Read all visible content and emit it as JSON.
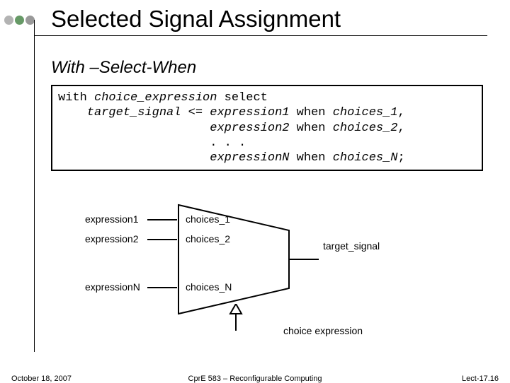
{
  "title": "Selected Signal Assignment",
  "subtitle": "With –Select-When",
  "code": {
    "l1a": "with ",
    "l1b": "choice_expression",
    "l1c": " select",
    "l2a": "    target_signal",
    "l2b": " <= ",
    "l2c": "expression1",
    "l2d": " when ",
    "l2e": "choices_1",
    "l2f": ",",
    "l3a": "                     ",
    "l3b": "expression2",
    "l3c": " when ",
    "l3d": "choices_2",
    "l3e": ",",
    "l4": "                     . . .",
    "l5a": "                     ",
    "l5b": "expressionN",
    "l5c": " when ",
    "l5d": "choices_N",
    "l5e": ";"
  },
  "diagram": {
    "in1": "expression1",
    "in2": "expression2",
    "inN": "expressionN",
    "ch1": "choices_1",
    "ch2": "choices_2",
    "chN": "choices_N",
    "out": "target_signal",
    "sel": "choice expression"
  },
  "footer": {
    "left": "October 18, 2007",
    "center": "CprE 583 – Reconfigurable Computing",
    "right": "Lect-17.16"
  }
}
